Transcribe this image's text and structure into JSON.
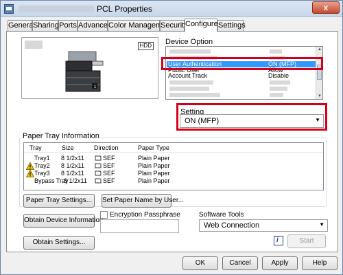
{
  "window": {
    "title": "PCL Properties",
    "close_glyph": "x"
  },
  "tabs": [
    {
      "label": "General"
    },
    {
      "label": "Sharing"
    },
    {
      "label": "Ports"
    },
    {
      "label": "Advanced"
    },
    {
      "label": "Color Management"
    },
    {
      "label": "Security"
    },
    {
      "label": "Configure"
    },
    {
      "label": "Settings"
    }
  ],
  "active_tab": "Configure",
  "preview": {
    "hdd_badge": "HDD"
  },
  "device_option": {
    "label": "Device Option",
    "rows": [
      {
        "name": "User Authentication",
        "value": "ON (MFP)",
        "selected": true
      },
      {
        "name": "Public User",
        "value": "Allow",
        "selected": false
      },
      {
        "name": "Account Track",
        "value": "Disable",
        "selected": false
      }
    ]
  },
  "setting": {
    "label": "Setting",
    "value": "ON (MFP)"
  },
  "paper_tray": {
    "title": "Paper Tray Information",
    "columns": [
      "Tray",
      "Size",
      "Direction",
      "Paper Type"
    ],
    "rows": [
      {
        "tray": "Tray1",
        "size": "8 1/2x11",
        "direction": "SEF",
        "type": "Plain Paper",
        "warning": false
      },
      {
        "tray": "Tray2",
        "size": "8 1/2x11",
        "direction": "SEF",
        "type": "Plain Paper",
        "warning": true
      },
      {
        "tray": "Tray3",
        "size": "8 1/2x11",
        "direction": "SEF",
        "type": "Plain Paper",
        "warning": true
      },
      {
        "tray": "Bypass Tray",
        "size": "8 1/2x11",
        "direction": "SEF",
        "type": "Plain Paper",
        "warning": false
      }
    ],
    "paper_tray_settings_button": "Paper Tray Settings...",
    "set_paper_name_button": "Set Paper Name by User..."
  },
  "obtain_device_info_button": "Obtain Device Information",
  "obtain_settings_button": "Obtain Settings...",
  "encryption": {
    "label": "Encryption Passphrase",
    "value": ""
  },
  "software_tools": {
    "label": "Software Tools",
    "value": "Web Connection",
    "start_button": "Start"
  },
  "footer": {
    "ok": "OK",
    "cancel": "Cancel",
    "apply": "Apply",
    "help": "Help"
  },
  "colors": {
    "accent_highlight": "#3399ff",
    "callout_red": "#d4001a"
  },
  "icons": {
    "info": "info-icon",
    "warning": "warning-icon",
    "paper": "paper-sef-icon"
  }
}
